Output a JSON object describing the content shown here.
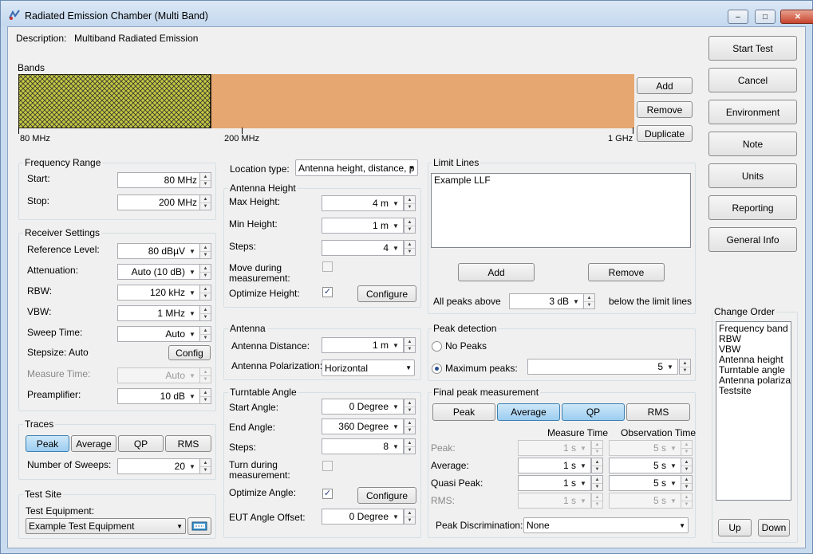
{
  "window": {
    "title": "Radiated Emission Chamber (Multi Band)",
    "min": "–",
    "max": "□",
    "close": "✕"
  },
  "description": {
    "label": "Description:",
    "value": "Multiband Radiated Emission"
  },
  "bands": {
    "label": "Bands",
    "start": "80 MHz",
    "mid": "200 MHz",
    "end": "1 GHz",
    "selected_fraction": 0.3125,
    "color_selected": "#c5c840",
    "color_band": "#e6a771",
    "add": "Add",
    "remove": "Remove",
    "duplicate": "Duplicate"
  },
  "side_buttons": [
    "Start Test",
    "Cancel",
    "Environment",
    "Note",
    "Units",
    "Reporting",
    "General Info"
  ],
  "frequency": {
    "label": "Frequency Range",
    "start_label": "Start:",
    "start": "80 MHz",
    "stop_label": "Stop:",
    "stop": "200 MHz"
  },
  "receiver": {
    "label": "Receiver Settings",
    "ref_label": "Reference Level:",
    "ref": "80 dBµV",
    "att_label": "Attenuation:",
    "att": "Auto (10 dB)",
    "rbw_label": "RBW:",
    "rbw": "120 kHz",
    "vbw_label": "VBW:",
    "vbw": "1 MHz",
    "sweep_label": "Sweep Time:",
    "sweep": "Auto",
    "stepsize_label": "Stepsize: Auto",
    "config": "Config",
    "measure_label": "Measure Time:",
    "measure": "Auto",
    "preamp_label": "Preamplifier:",
    "preamp": "10 dB"
  },
  "traces": {
    "label": "Traces",
    "buttons": [
      "Peak",
      "Average",
      "QP",
      "RMS"
    ],
    "sweeps_label": "Number of Sweeps:",
    "sweeps": "20"
  },
  "test_site": {
    "label": "Test Site",
    "equipment_label": "Test Equipment:",
    "equipment": "Example Test Equipment"
  },
  "location": {
    "label": "Location type:",
    "value": "Antenna height, distance, p"
  },
  "antenna_height": {
    "label": "Antenna Height",
    "max_label": "Max Height:",
    "max": "4 m",
    "min_label": "Min Height:",
    "min": "1 m",
    "steps_label": "Steps:",
    "steps": "4",
    "move_label_1": "Move during",
    "move_label_2": "measurement:",
    "optimize_label": "Optimize Height:",
    "configure": "Configure"
  },
  "antenna": {
    "label": "Antenna",
    "distance_label": "Antenna Distance:",
    "distance": "1 m",
    "pol_label": "Antenna Polarization:",
    "pol": "Horizontal"
  },
  "turntable": {
    "label": "Turntable Angle",
    "start_label": "Start Angle:",
    "start": "0 Degree",
    "end_label": "End Angle:",
    "end": "360 Degree",
    "steps_label": "Steps:",
    "steps": "8",
    "turn_label_1": "Turn during",
    "turn_label_2": "measurement:",
    "optimize_label": "Optimize Angle:",
    "configure": "Configure",
    "offset_label": "EUT Angle Offset:",
    "offset": "0 Degree"
  },
  "limit_lines": {
    "label": "Limit Lines",
    "items": [
      "Example LLF"
    ],
    "add": "Add",
    "remove": "Remove",
    "peaks_label": "All peaks above",
    "peaks_value": "3 dB",
    "below_label": "below the limit lines"
  },
  "peak_detection": {
    "label": "Peak detection",
    "no_peaks": "No Peaks",
    "max_peaks": "Maximum peaks:",
    "max_value": "5"
  },
  "final_peak": {
    "label": "Final peak measurement",
    "buttons": [
      "Peak",
      "Average",
      "QP",
      "RMS"
    ],
    "measure_time": "Measure Time",
    "observation_time": "Observation Time",
    "rows": [
      {
        "label": "Peak:",
        "m": "1 s",
        "o": "5 s"
      },
      {
        "label": "Average:",
        "m": "1 s",
        "o": "5 s"
      },
      {
        "label": "Quasi Peak:",
        "m": "1 s",
        "o": "5 s"
      },
      {
        "label": "RMS:",
        "m": "1 s",
        "o": "5 s"
      }
    ],
    "disc_label": "Peak Discrimination:",
    "disc": "None"
  },
  "change_order": {
    "label": "Change Order",
    "items": [
      "Frequency band",
      "RBW",
      "VBW",
      "Antenna height",
      "Turntable angle",
      "Antenna polarizati",
      "Testsite"
    ],
    "up": "Up",
    "down": "Down"
  }
}
